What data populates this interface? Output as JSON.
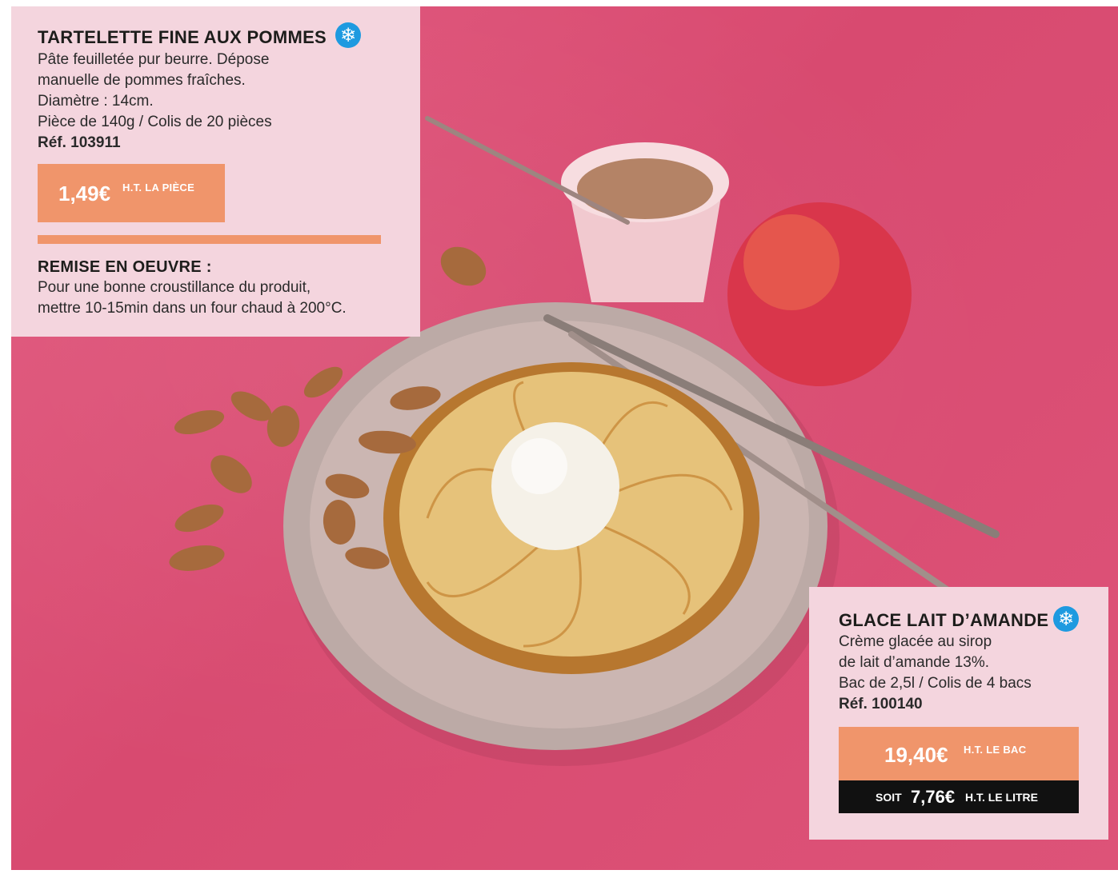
{
  "product1": {
    "title": "TARTELETTE FINE AUX POMMES",
    "frozen_icon": "snowflake-icon",
    "description": [
      "Pâte feuilletée pur beurre. Dépose",
      "manuelle de pommes fraîches.",
      "Diamètre : 14cm.",
      "Pièce de 140g / Colis de 20 pièces"
    ],
    "ref": "Réf. 103911",
    "price": "1,49€",
    "price_unit": "H.T. LA PIÈCE",
    "prep_title": "REMISE EN OEUVRE :",
    "prep_text": [
      "Pour une bonne croustillance du produit,",
      "mettre 10-15min dans un four chaud à 200°C."
    ]
  },
  "product2": {
    "title": "GLACE LAIT D’AMANDE",
    "frozen_icon": "snowflake-icon",
    "description": [
      "Crème glacée au sirop",
      "de lait d’amande 13%.",
      "Bac de 2,5l / Colis de 4 bacs"
    ],
    "ref": "Réf. 100140",
    "price": "19,40€",
    "price_unit": "H.T. LE BAC",
    "soit_label": "SOIT",
    "liter_price": "7,76€",
    "liter_unit": "H.T. LE LITRE"
  },
  "colors": {
    "background_pink": "#dd5378",
    "card_pink": "#f4d5de",
    "price_orange": "#f0956b",
    "snow_blue": "#1e9ae0"
  }
}
